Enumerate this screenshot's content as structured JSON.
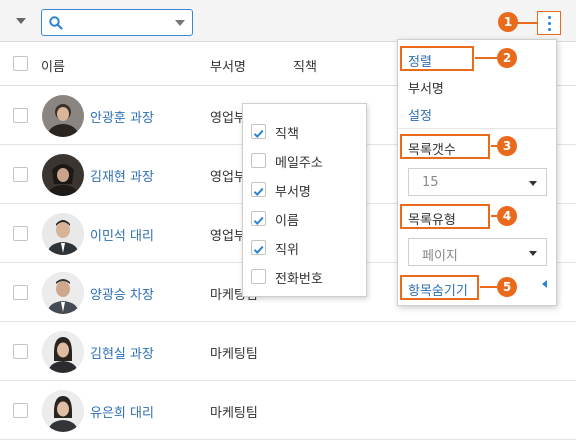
{
  "toolbar": {
    "search_value": "",
    "search_icon": "search-icon",
    "more_icon": "vertical-ellipsis-icon"
  },
  "table": {
    "headers": {
      "name": "이름",
      "dept": "부서명",
      "title": "직책"
    },
    "rows": [
      {
        "name": "안광훈 과장",
        "dept": "영업부",
        "avatar": "avatar-photo"
      },
      {
        "name": "김재현 과장",
        "dept": "영업부",
        "avatar": "avatar-photo"
      },
      {
        "name": "이민석 대리",
        "dept": "영업부",
        "avatar": "avatar-photo"
      },
      {
        "name": "양광승 차장",
        "dept": "마케팅팀",
        "avatar": "avatar-photo"
      },
      {
        "name": "김현실 과장",
        "dept": "마케팅팀",
        "avatar": "avatar-photo"
      },
      {
        "name": "유은희 대리",
        "dept": "마케팅팀",
        "avatar": "avatar-photo"
      }
    ]
  },
  "column_picker": {
    "items": [
      {
        "label": "직책",
        "checked": true
      },
      {
        "label": "메일주소",
        "checked": false
      },
      {
        "label": "부서명",
        "checked": true
      },
      {
        "label": "이름",
        "checked": true
      },
      {
        "label": "직위",
        "checked": true
      },
      {
        "label": "전화번호",
        "checked": false
      }
    ]
  },
  "menu": {
    "sort_label": "정렬",
    "sort_option": "부서명",
    "settings_label": "설정",
    "count_label": "목록갯수",
    "count_value": "15",
    "type_label": "목록유형",
    "type_value": "페이지",
    "hide_label": "항목숨기기"
  },
  "callouts": [
    "1",
    "2",
    "3",
    "4",
    "5"
  ],
  "colors": {
    "accent": "#ea6a1b",
    "link": "#2d6fb5",
    "primary": "#2b83d4"
  }
}
